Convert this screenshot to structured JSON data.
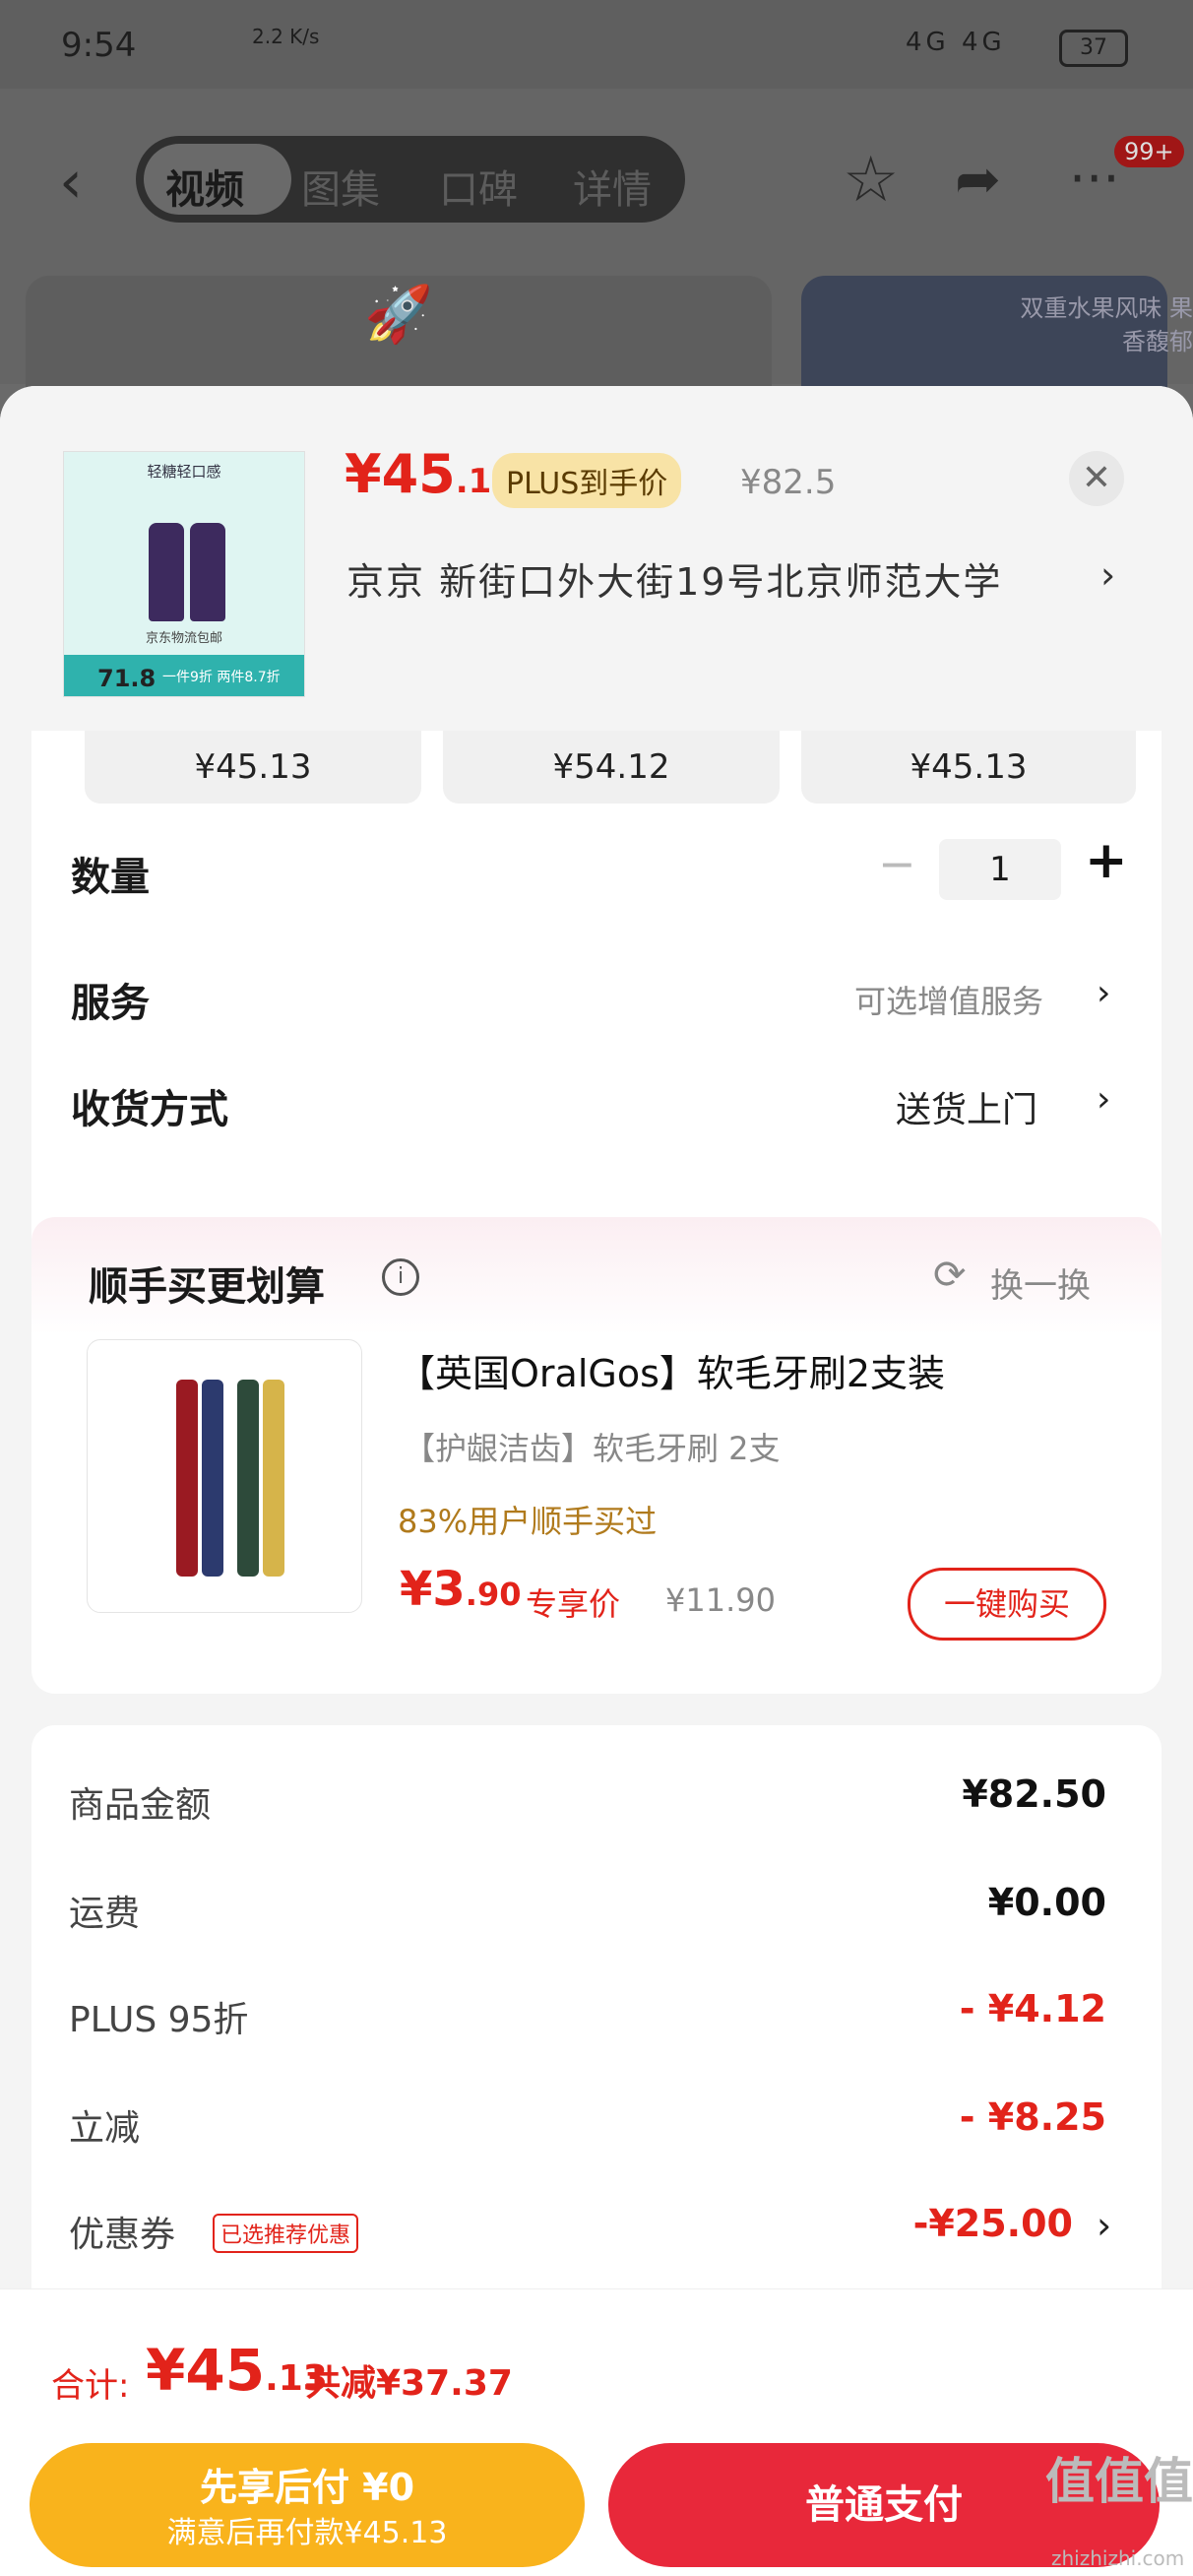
{
  "status_bar": {
    "time": "9:54",
    "net_speed": "2.2 K/s",
    "signal": "4G 4G",
    "battery": "37"
  },
  "nav": {
    "tabs": [
      "视频",
      "图集",
      "口碑",
      "详情"
    ],
    "badge": "99+"
  },
  "bg_card": {
    "text": "双重水果风味 果香馥郁"
  },
  "header": {
    "price_main": "¥45",
    "price_dec": ".13",
    "plus_label": "PLUS到手价",
    "orig_price": "¥82.5",
    "address": "京京   新街口外大街19号北京师范大学"
  },
  "thumb": {
    "tagline": "轻糖轻口感",
    "shipping": "京东物流包邮",
    "price": "71.8",
    "discount": "一件9折 两件8.7折"
  },
  "spec_prices": [
    "¥45.13",
    "¥54.12",
    "¥45.13"
  ],
  "quantity": {
    "label": "数量",
    "value": "1",
    "minus": "−",
    "plus": "+"
  },
  "service": {
    "label": "服务",
    "value": "可选增值服务"
  },
  "delivery": {
    "label": "收货方式",
    "value": "送货上门"
  },
  "bundle": {
    "title": "顺手买更划算",
    "refresh": "换一换",
    "name": "【英国OralGos】软毛牙刷2支装",
    "subtitle": "【护龈洁齿】软毛牙刷 2支",
    "social": "83%用户顺手买过",
    "price_main": "¥3",
    "price_dec": ".90",
    "price_label": "专享价",
    "orig_price": "¥11.90",
    "buy": "一键购买"
  },
  "costs": [
    {
      "label": "商品金额",
      "value": "¥82.50"
    },
    {
      "label": "运费",
      "value": "¥0.00"
    },
    {
      "label": "PLUS 95折",
      "value": "- ¥4.12"
    },
    {
      "label": "立减",
      "value": "- ¥8.25"
    },
    {
      "label": "优惠券",
      "value": "-¥25.00",
      "tag": "已选推荐优惠"
    }
  ],
  "footer": {
    "total_label": "合计:",
    "total_main": "¥45",
    "total_dec": ".13",
    "saved": "共减¥37.37",
    "bnpl_title": "先享后付 ¥0",
    "bnpl_sub": "满意后再付款¥45.13",
    "pay": "普通支付"
  },
  "watermark": {
    "text": "值值值",
    "site": "zhizhizhi.com"
  },
  "colors": {
    "accent": "#e2231a",
    "bnpl": "#f9b31c",
    "pay": "#e8283a"
  }
}
